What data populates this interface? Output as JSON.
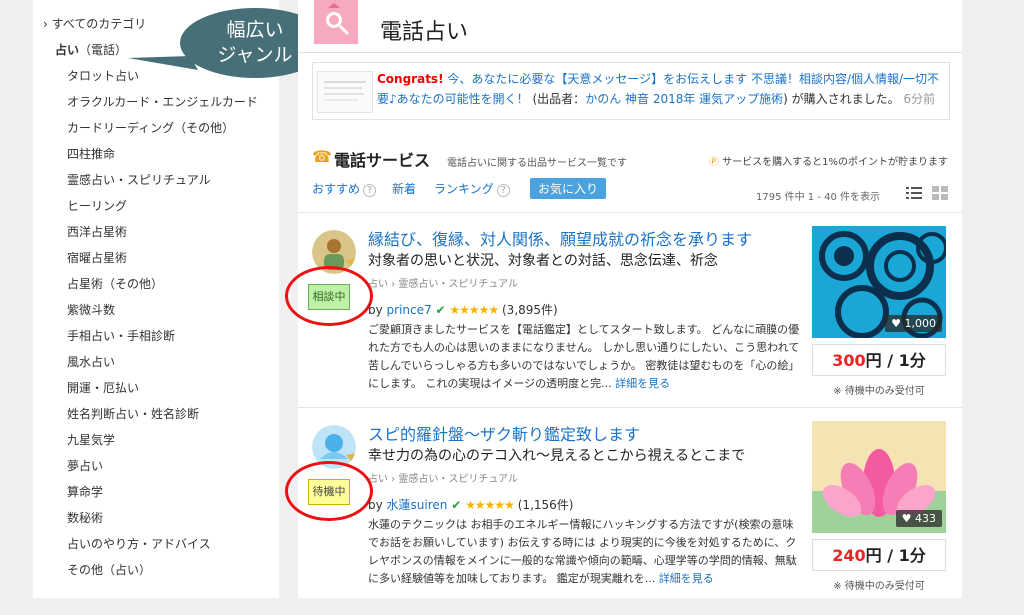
{
  "sidebar": {
    "root": "すべてのカテゴリ",
    "current": "占い",
    "current_sub": "（電話）",
    "items": [
      "タロット占い",
      "オラクルカード・エンジェルカード",
      "カードリーディング（その他）",
      "四柱推命",
      "霊感占い・スピリチュアル",
      "ヒーリング",
      "西洋占星術",
      "宿曜占星術",
      "占星術（その他）",
      "紫微斗数",
      "手相占い・手相診断",
      "風水占い",
      "開運・厄払い",
      "姓名判断占い・姓名診断",
      "九星気学",
      "夢占い",
      "算命学",
      "数秘術",
      "占いのやり方・アドバイス",
      "その他（占い）"
    ]
  },
  "callout": {
    "line1": "幅広い",
    "line2": "ジャンル"
  },
  "header": {
    "title": "電話占い"
  },
  "congrats": {
    "label": "Congrats!",
    "text1": "今、あなたに必要な【天意メッセージ】をお伝えします 不思議！相談内容/個人情報/一切不要♪あなたの可能性を開く！",
    "text2": "(出品者：",
    "seller": "かのん 神音 2018年 運気アップ施術",
    "text3": ") が購入されました。",
    "ago": "6分前"
  },
  "service": {
    "title": "電話サービス",
    "desc": "電話占いに関する出品サービス一覧です",
    "points": "サービスを購入すると1%のポイントが貯まります",
    "points_icon": "Ⓟ"
  },
  "tabs": [
    "おすすめ",
    "新着",
    "ランキング",
    "お気に入り"
  ],
  "result_count": "1795 件中 1 - 40 件を表示",
  "listings": [
    {
      "title": "縁結び、復縁、対人関係、願望成就の祈念を承ります",
      "subtitle": "対象者の思いと状況、対象者との対話、思念伝達、祈念",
      "cat1": "占い",
      "cat2": "霊感占い・スピリチュアル",
      "status": "相談中",
      "by": "by",
      "user": "prince7",
      "stars": "★★★★★",
      "reviews": "(3,895件)",
      "desc": "ご愛顧頂きましたサービスを【電話鑑定】としてスタート致します。 どんなに頑膜の優れた方でも人の心は思いのままになりません。 しかし思い通りにしたい、こう思われて苦しんでいらっしゃる方も多いのではないでしょうか。 密教徒は望むものを「心の絵」にします。 これの実現はイメージの透明度と完...",
      "more": "詳細を見る",
      "likes": "1,000",
      "price_num": "300",
      "price_unit": "円 / 1分",
      "note": "※ 待機中のみ受付可"
    },
    {
      "title": "スピ的羅針盤～ザク斬り鑑定致します",
      "subtitle": "幸せ力の為の心のテコ入れ～見えるとこから視えるとこまで",
      "cat1": "占い",
      "cat2": "霊感占い・スピリチュアル",
      "status": "待機中",
      "by": "by",
      "user": "水蓮suiren",
      "stars": "★★★★★",
      "reviews": "(1,156件)",
      "desc": "水蓮のテクニックは お相手のエネルギー情報にハッキングする方法ですが(検索の意味でお話をお願いしています) お伝えする時には より現実的に今後を対処するために、クレヤボンスの情報をメインに一般的な常識や傾向の範疇、心理学等の学問的情報、無駄に多い経験値等を加味しております。 鑑定が現実離れを...",
      "more": "詳細を見る",
      "likes": "433",
      "price_num": "240",
      "price_unit": "円 / 1分",
      "note": "※ 待機中のみ受付可"
    }
  ]
}
